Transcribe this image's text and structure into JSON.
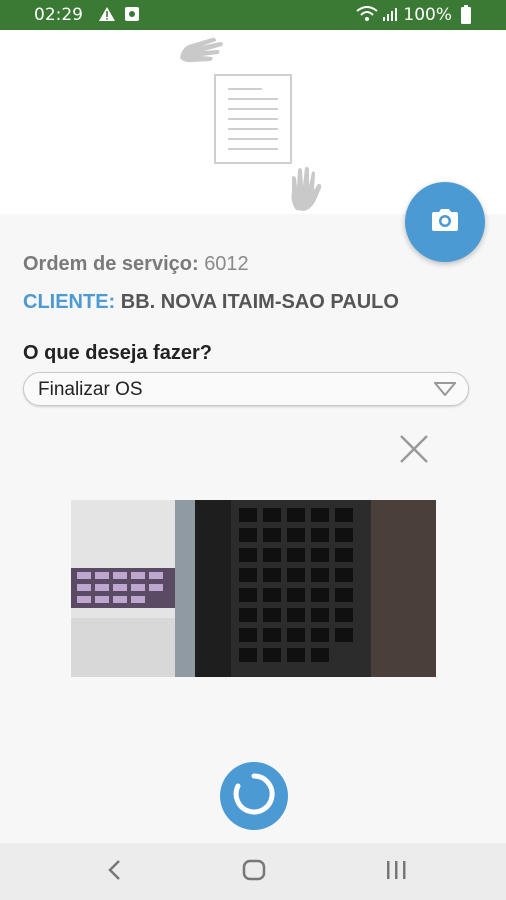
{
  "statusbar": {
    "time": "02:29",
    "battery": "100%"
  },
  "icons": {
    "alert": "warning-icon",
    "notify": "notification-icon",
    "wifi": "wifi-icon",
    "signal": "signal-icon",
    "battery": "battery-icon",
    "camera": "camera-icon",
    "close": "close-icon",
    "chevron": "chevron-down-icon",
    "spinner": "loading-spinner-icon"
  },
  "order": {
    "label": "Ordem de serviço:",
    "number": "6012"
  },
  "client": {
    "label": "CLIENTE:",
    "name": "BB. NOVA ITAIM-SAO PAULO"
  },
  "question": "O que deseja fazer?",
  "select": {
    "value": "Finalizar OS"
  },
  "colors": {
    "status": "#3a7a34",
    "accent": "#4b9ad3"
  }
}
